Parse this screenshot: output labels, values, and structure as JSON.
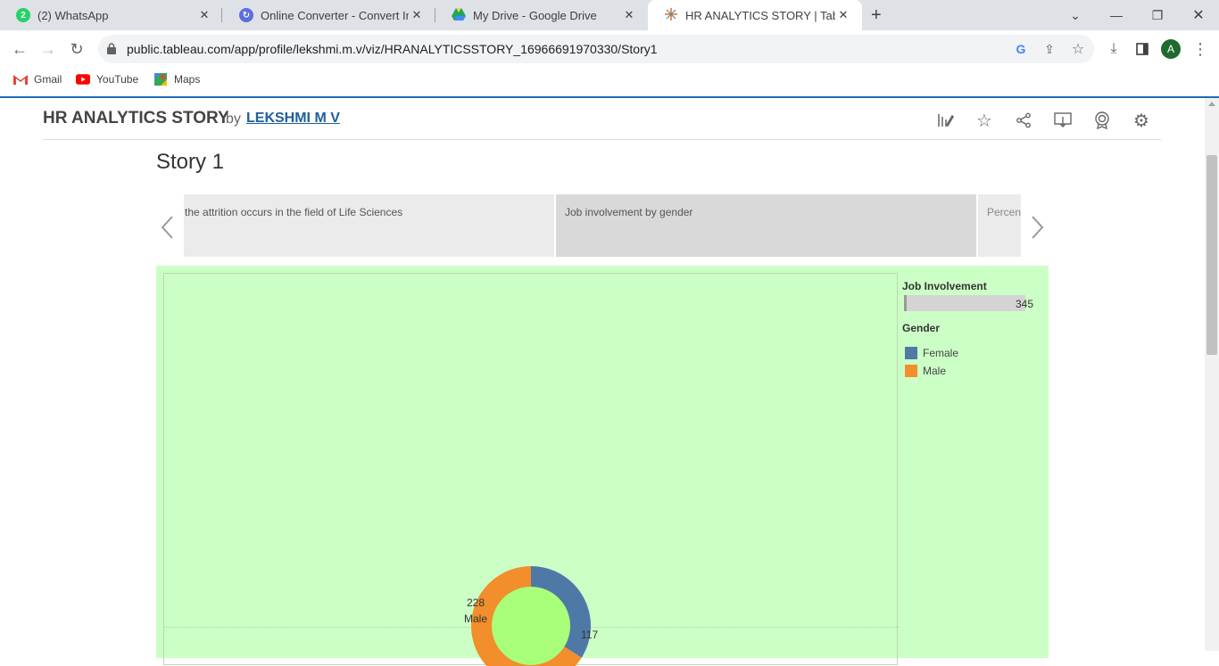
{
  "tabs": [
    {
      "title": "(2) WhatsApp",
      "icon": "whatsapp-icon",
      "badge": "2"
    },
    {
      "title": "Online Converter - Convert Imag",
      "icon": "converter-icon"
    },
    {
      "title": "My Drive - Google Drive",
      "icon": "google-drive-icon"
    },
    {
      "title": "HR ANALYTICS STORY | Tableau",
      "icon": "tableau-icon"
    }
  ],
  "address_bar": {
    "url": "public.tableau.com/app/profile/lekshmi.m.v/viz/HRANALYTICSSTORY_16966691970330/Story1"
  },
  "avatar_initial": "A",
  "bookmarks": [
    {
      "label": "Gmail",
      "icon": "gmail-icon"
    },
    {
      "label": "YouTube",
      "icon": "youtube-icon"
    },
    {
      "label": "Maps",
      "icon": "maps-icon"
    }
  ],
  "viz": {
    "title": "HR ANALYTICS STORY",
    "by": "by",
    "author": "LEKSHMI M V"
  },
  "story": {
    "title": "Story 1",
    "points": [
      "the attrition occurs in the field of Life Sciences",
      "Job involvement by gender",
      "Percen"
    ]
  },
  "legend": {
    "measure_title": "Job Involvement",
    "measure_max": "345",
    "color_title": "Gender",
    "items": [
      {
        "label": "Female",
        "color": "#4e79a7"
      },
      {
        "label": "Male",
        "color": "#f28e2b"
      }
    ]
  },
  "chart_data": {
    "type": "pie",
    "title": "",
    "categories": [
      "Female",
      "Male"
    ],
    "values": [
      117,
      228
    ],
    "labels": {
      "male_value": "228",
      "male_name": "Male",
      "female_value": "117"
    },
    "colors": [
      "#4e79a7",
      "#f28e2b"
    ],
    "center_color": "#a9ff7a"
  },
  "colors": {
    "dashboard_bg": "#ccffc6",
    "accent": "#1f6bb0"
  }
}
